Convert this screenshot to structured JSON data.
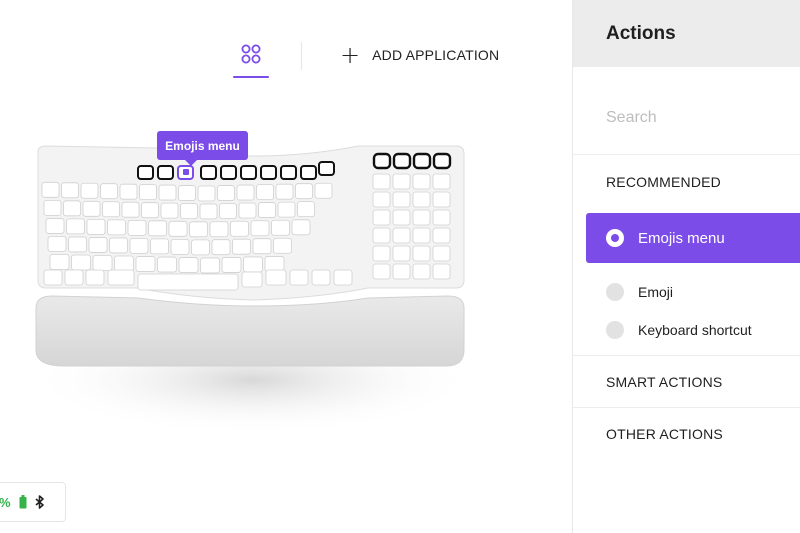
{
  "header_tabs": {
    "devices_icon": "apps-grid-icon",
    "add_application_label": "ADD APPLICATION",
    "add_icon": "plus-icon"
  },
  "keyboard": {
    "tooltip_label": "Emojis menu",
    "highlighted_key": "emoji-key"
  },
  "status": {
    "battery_percent": "%",
    "battery_icon": "battery-icon",
    "connection_icon": "bluetooth-icon"
  },
  "panel": {
    "title": "Actions",
    "search_placeholder": "Search",
    "sections": {
      "recommended": "RECOMMENDED",
      "smart_actions": "SMART ACTIONS",
      "other_actions": "OTHER ACTIONS"
    },
    "options": [
      {
        "label": "Emojis menu",
        "selected": true
      },
      {
        "label": "Emoji",
        "selected": false
      },
      {
        "label": "Keyboard shortcut",
        "selected": false
      }
    ]
  },
  "colors": {
    "accent": "#7b4ce8",
    "battery_green": "#36b34a",
    "panel_header_bg": "#ececec"
  }
}
